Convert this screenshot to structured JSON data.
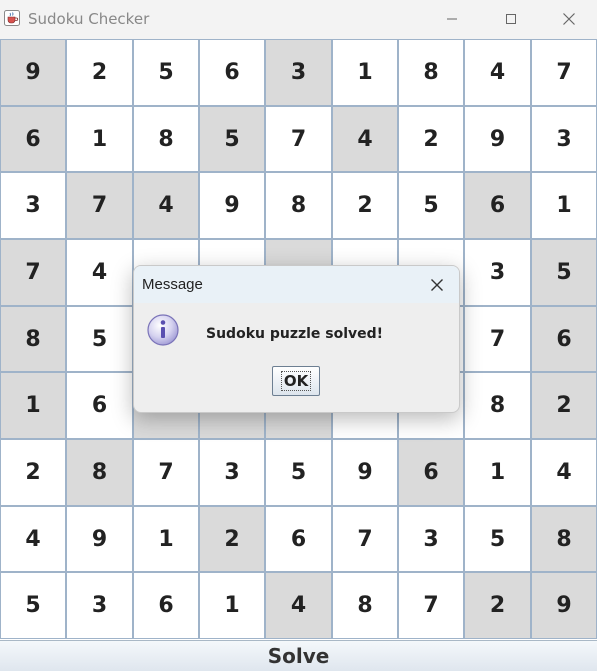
{
  "window": {
    "title": "Sudoku Checker",
    "app_icon": "java-cup-icon"
  },
  "board": {
    "grid": [
      [
        "9",
        "2",
        "5",
        "6",
        "3",
        "1",
        "8",
        "4",
        "7"
      ],
      [
        "6",
        "1",
        "8",
        "5",
        "7",
        "4",
        "2",
        "9",
        "3"
      ],
      [
        "3",
        "7",
        "4",
        "9",
        "8",
        "2",
        "5",
        "6",
        "1"
      ],
      [
        "7",
        "4",
        "",
        "",
        "",
        "",
        "",
        "3",
        "5"
      ],
      [
        "8",
        "5",
        "",
        "",
        "",
        "",
        "",
        "7",
        "6"
      ],
      [
        "1",
        "6",
        "",
        "",
        "",
        "",
        "",
        "8",
        "2"
      ],
      [
        "2",
        "8",
        "7",
        "3",
        "5",
        "9",
        "6",
        "1",
        "4"
      ],
      [
        "4",
        "9",
        "1",
        "2",
        "6",
        "7",
        "3",
        "5",
        "8"
      ],
      [
        "5",
        "3",
        "6",
        "1",
        "4",
        "8",
        "7",
        "2",
        "9"
      ]
    ],
    "shaded": [
      [
        1,
        0,
        0,
        0,
        1,
        0,
        0,
        0,
        0
      ],
      [
        1,
        0,
        0,
        1,
        0,
        1,
        0,
        0,
        0
      ],
      [
        0,
        1,
        1,
        0,
        0,
        0,
        0,
        1,
        0
      ],
      [
        1,
        0,
        0,
        0,
        1,
        0,
        0,
        0,
        1
      ],
      [
        1,
        0,
        0,
        0,
        1,
        0,
        0,
        0,
        1
      ],
      [
        1,
        0,
        1,
        1,
        1,
        0,
        0,
        0,
        1
      ],
      [
        0,
        1,
        0,
        0,
        0,
        0,
        1,
        0,
        0
      ],
      [
        0,
        0,
        0,
        1,
        0,
        0,
        0,
        0,
        1
      ],
      [
        0,
        0,
        0,
        0,
        1,
        0,
        0,
        1,
        1
      ]
    ],
    "colors": {
      "shaded": "#dadada",
      "white": "#ffffff",
      "border": "#9fb3c9"
    }
  },
  "solve_button": {
    "label": "Solve"
  },
  "dialog": {
    "title": "Message",
    "message": "Sudoku puzzle solved!",
    "ok_label": "OK",
    "icon": "information-icon"
  }
}
